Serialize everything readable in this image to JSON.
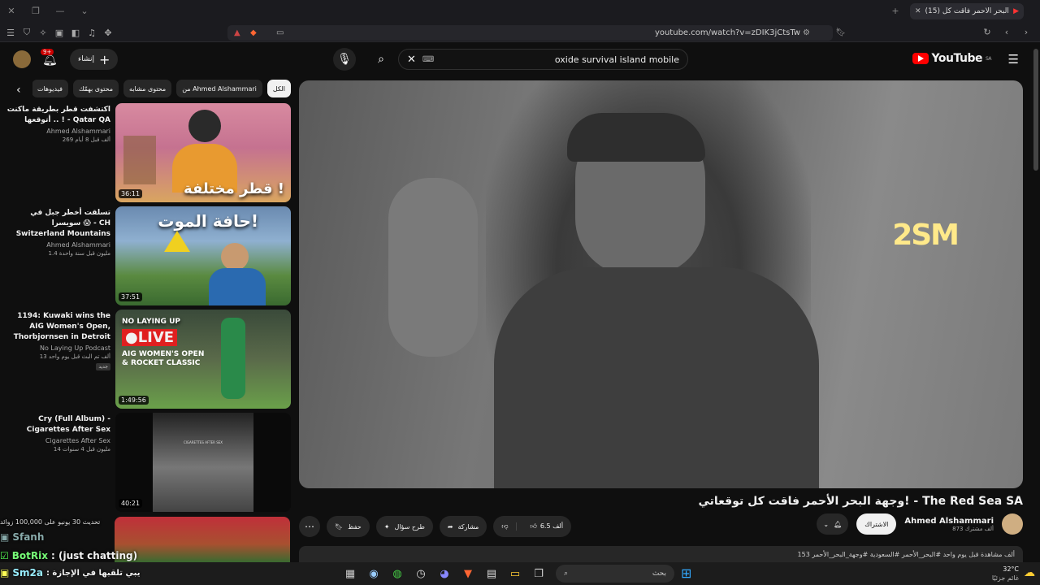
{
  "browser": {
    "tab_title": "(15) وجهة البحر الأحمر فاقت كل",
    "url": "youtube.com/watch?v=zDIK3jCtsTw"
  },
  "yt": {
    "search_query": "oxide survival island mobile",
    "logo": "YouTube",
    "logo_region": "SA",
    "create_label": "إنشاء",
    "notif_count": "9+"
  },
  "chips": [
    "الكل",
    "من Ahmed Alshammari",
    "محتوى مشابه",
    "محتوى بهمّك",
    "فيديوهات"
  ],
  "recs": [
    {
      "title": "اكتشفت قطر بطريقة ماكنت أتوقعها .. ! - Qatar QA",
      "channel": "Ahmed Alshammari",
      "meta": "269 ألف  قبل 8 أيام",
      "duration": "36:11",
      "overlay": "قطر مختلفة !"
    },
    {
      "title": "تسلقت أخطر جبل في سويسرا 😱 - CH Switzerland Mountains",
      "channel": "Ahmed Alshammari",
      "meta": "1.4 مليون  قبل سنة واحدة",
      "duration": "37:51",
      "overlay": "حافة الموت!"
    },
    {
      "title": "1194: Kuwaki wins the AIG Women's Open, Thorbjornsen in Detroit",
      "channel": "No Laying Up Podcast",
      "meta": "13 ألف  تم البث قبل يوم واحد",
      "duration": "1:49:56",
      "overlay": "NO LAYING UP",
      "badge": "جديد"
    },
    {
      "title": "Cry (Full Album) - Cigarettes After Sex",
      "channel": "Cigarettes After Sex",
      "meta": "14 مليون  قبل 4 سنوات",
      "duration": "40:21",
      "overlay": "CIGARETTES AFTER SEX"
    }
  ],
  "video": {
    "title": "وجهة البحر الأحمر فاقت كل توقعاتي! - The Red Sea SA",
    "channel": "Ahmed Alshammari",
    "subs": "873 ألف مشترك",
    "subscribe": "الاشتراك",
    "likes": "6.5 ألف",
    "share": "مشاركة",
    "ask": "طرح سؤال",
    "save": "حفظ",
    "desc": "153 ألف مشاهدة قبل يوم واحد  #البحر_الأحمر #السعودية #وجهة_البحر_الأحمر",
    "watermark": "2SM"
  },
  "overlay_chat": {
    "line1": "تحديث 30 يونيو على 100,000 زوائد",
    "user1": "Sfanh",
    "user2": "BotRix",
    "msg2": ": (just chatting)",
    "user3": "Sm2a",
    "msg3": ": يبي تلقبها في الإجازة"
  },
  "taskbar": {
    "search": "بحث",
    "weather_temp": "32°C",
    "weather_desc": "غائم جزئيًا"
  }
}
